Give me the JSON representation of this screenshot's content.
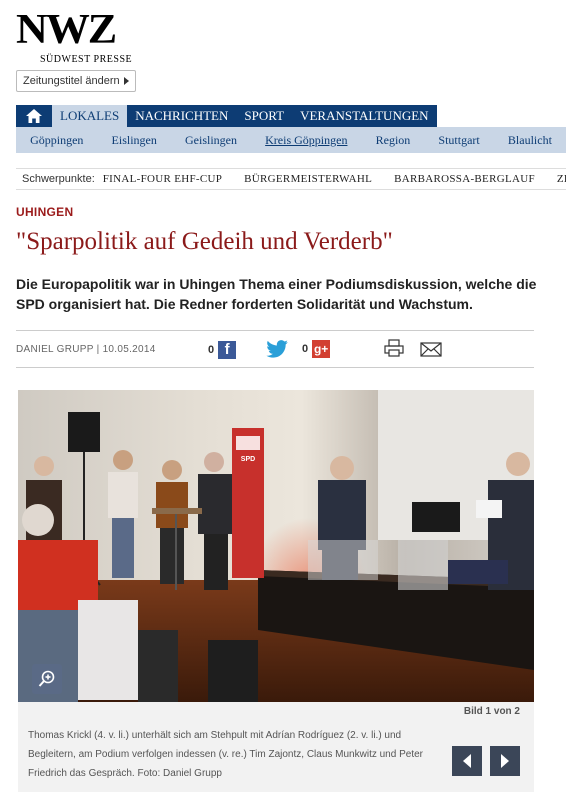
{
  "logo": {
    "mark": "NWZ",
    "subtitle": "SÜDWEST PRESSE"
  },
  "title_change": {
    "label": "Zeitungstitel ändern"
  },
  "main_nav": [
    "LOKALES",
    "NACHRICHTEN",
    "SPORT",
    "VERANSTALTUNGEN"
  ],
  "sub_nav": [
    "Göppingen",
    "Eislingen",
    "Geislingen",
    "Kreis Göppingen",
    "Region",
    "Stuttgart",
    "Blaulicht"
  ],
  "focus": {
    "label": "Schwerpunkte:",
    "items": [
      "FINAL-FOUR EHF-CUP",
      "BÜRGERMEISTERWAHL",
      "BARBAROSSA-BERGLAUF",
      "ZEHN"
    ]
  },
  "article": {
    "kicker": "UHINGEN",
    "headline": "\"Sparpolitik auf Gedeih und Verderb\"",
    "lead": "Die Europapolitik war in Uhingen Thema einer Podiumsdiskussion, welche die SPD organisiert hat. Die Redner forderten Solidarität und Wachstum.",
    "byline": "DANIEL GRUPP | 10.05.2014",
    "share_counts": {
      "facebook": "0",
      "googleplus": "0"
    }
  },
  "gallery": {
    "counter": "Bild 1 von 2",
    "caption": "Thomas Krickl (4. v. li.) unterhält sich am Stehpult mit Adrían Rodríguez (2. v. li.) und Begleitern, am Podium verfolgen indessen (v. re.) Tim Zajontz, Claus Munkwitz und Peter Friedrich das Gespräch. Foto: Daniel Grupp",
    "banner_text": "SPD"
  },
  "colors": {
    "nav": "#0d3c74",
    "subnav": "#c9d6e6",
    "headline": "#8b1a1a",
    "kicker": "#9b1b1b"
  }
}
